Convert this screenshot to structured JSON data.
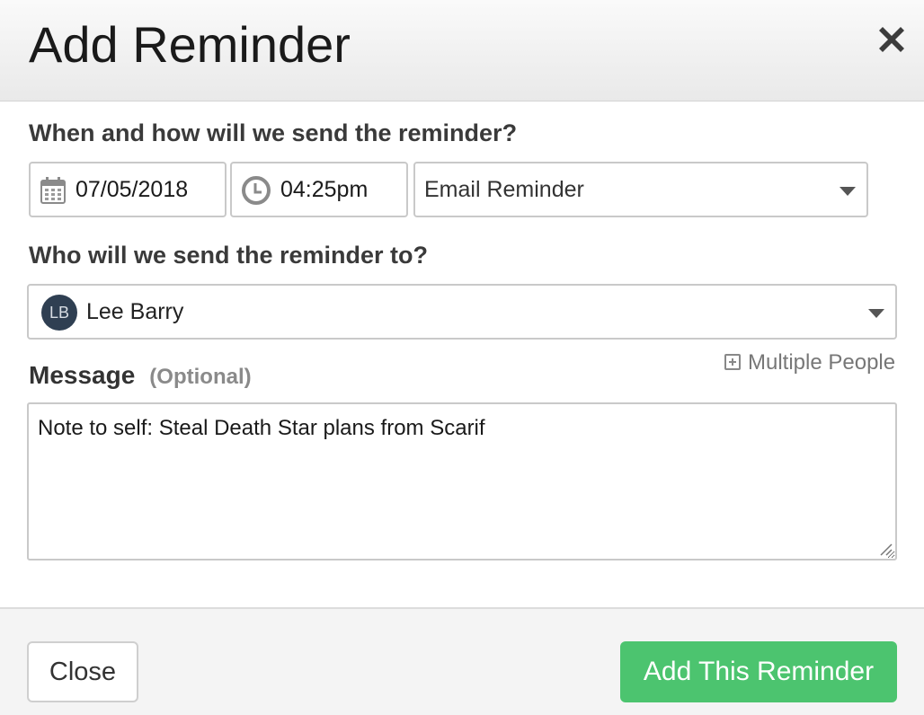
{
  "dialog": {
    "title": "Add Reminder",
    "close_icon": "close-x-icon"
  },
  "schedule": {
    "label": "When and how will we send the reminder?",
    "date": "07/05/2018",
    "date_icon": "calendar-icon",
    "time": "04:25pm",
    "time_icon": "clock-icon",
    "method": "Email Reminder"
  },
  "recipient": {
    "label": "Who will we send the reminder to?",
    "avatar_initials": "LB",
    "name": "Lee Barry",
    "multiple_people_label": "Multiple People"
  },
  "message": {
    "label": "Message",
    "optional_label": "(Optional)",
    "value": "Note to self: Steal Death Star plans from Scarif"
  },
  "footer": {
    "close_label": "Close",
    "submit_label": "Add This Reminder"
  },
  "colors": {
    "accent_green": "#4cc46f",
    "avatar_bg": "#2f3f52"
  }
}
